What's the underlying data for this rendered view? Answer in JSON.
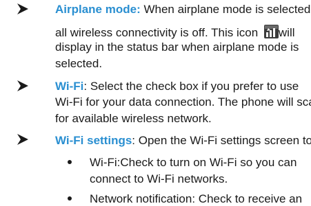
{
  "items": [
    {
      "term": "Airplane mode:",
      "line1_rest": " When airplane mode is selected,",
      "line2_start": "all wireless connectivity is off. This icon",
      "line2_end": "will",
      "line3": "display in the status bar when airplane mode is",
      "line4": "selected."
    },
    {
      "term": "Wi-Fi",
      "line1_rest": ": Select the check box if you prefer to use",
      "line2": "Wi-Fi for your data connection. The phone will scan",
      "line3": "for available wireless network."
    },
    {
      "term": "Wi-Fi settings",
      "line1_rest": ": Open the Wi-Fi settings screen to"
    }
  ],
  "subitems": [
    {
      "line1": "Wi-Fi:Check to turn on Wi-Fi so you can",
      "line2": "connect to Wi-Fi networks."
    },
    {
      "line1": "Network notification: Check to receive an"
    }
  ],
  "icons": {
    "bullet": "arrowhead-bullet-icon",
    "sub_bullet": "dot-bullet-icon",
    "status_icon": "airplane-mode-status-icon"
  },
  "colors": {
    "term": "#2a8fd1",
    "text": "#1a1a1a"
  }
}
